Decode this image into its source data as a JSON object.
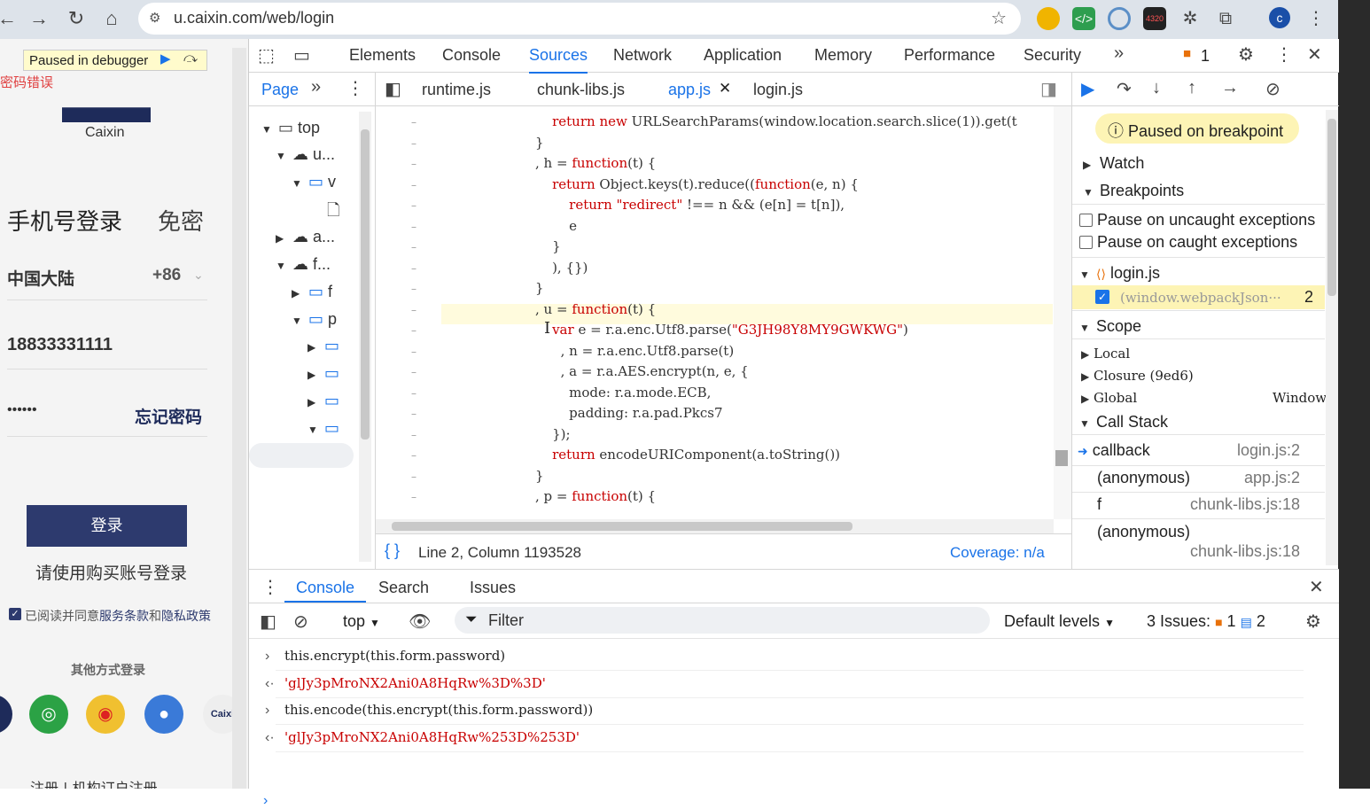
{
  "browser": {
    "url": "u.caixin.com/web/login"
  },
  "page": {
    "debugger_badge": "Paused in debugger",
    "error_text": "密码错误",
    "logo_text": "Caixin",
    "tab_phone": "手机号登录",
    "tab_free": "免密",
    "region": "中国大陆",
    "code": "+86",
    "phone": "18833331111",
    "password_mask": "••••••",
    "forgot": "忘记密码",
    "login_btn": "登录",
    "hint": "请使用购买账号登录",
    "agree_pre": "已阅读并同意",
    "agree_terms": "服务条款",
    "agree_and": "和",
    "agree_privacy": "隐私政策",
    "other": "其他方式登录",
    "footer": "注册 | 机构订户注册"
  },
  "devtools": {
    "tabs": [
      "Elements",
      "Console",
      "Sources",
      "Network",
      "Application",
      "Memory",
      "Performance",
      "Security"
    ],
    "issues_count": "1",
    "nav_tab": "Page",
    "tree": {
      "top": "top",
      "u": "u...",
      "v": "v",
      "a": "a...",
      "f": "f...",
      "f2": "f",
      "p": "p"
    },
    "file_tabs": [
      "runtime.js",
      "chunk-libs.js",
      "app.js",
      "login.js"
    ],
    "code_lines": [
      "    return new URLSearchParams(window.location.search.slice(1)).get(t",
      "}",
      ", h = function(t) {",
      "    return Object.keys(t).reduce((function(e, n) {",
      "        return \"redirect\" !== n && (e[n] = t[n]),",
      "        e",
      "    }",
      "    ), {})",
      "}",
      ", u = function(t) {",
      "    var e = r.a.enc.Utf8.parse(\"G3JH98Y8MY9GWKWG\")",
      "      , n = r.a.enc.Utf8.parse(t)",
      "      , a = r.a.AES.encrypt(n, e, {",
      "        mode: r.a.mode.ECB,",
      "        padding: r.a.pad.Pkcs7",
      "    });",
      "    return encodeURIComponent(a.toString())",
      "}",
      ", p = function(t) {"
    ],
    "status": {
      "position": "Line 2, Column 1193528",
      "coverage": "Coverage: n/a"
    },
    "debugger": {
      "paused": "Paused on breakpoint",
      "watch": "Watch",
      "breakpoints": "Breakpoints",
      "uncaught": "Pause on uncaught exceptions",
      "caught": "Pause on caught exceptions",
      "bp_file": "login.js",
      "bp_code": "(window.webpackJson···",
      "bp_line": "2",
      "scope": "Scope",
      "local": "Local",
      "closure": "Closure (9ed6)",
      "global": "Global",
      "global_val": "Window",
      "callstack": "Call Stack",
      "frames": [
        {
          "name": "callback",
          "loc": "login.js:2"
        },
        {
          "name": "(anonymous)",
          "loc": "app.js:2"
        },
        {
          "name": "f",
          "loc": "chunk-libs.js:18"
        },
        {
          "name": "(anonymous)",
          "loc": "chunk-libs.js:18"
        }
      ]
    },
    "drawer": {
      "tabs": [
        "Console",
        "Search",
        "Issues"
      ],
      "context": "top",
      "filter": "Filter",
      "levels": "Default levels",
      "issues_label": "3 Issues:",
      "issues_warn": "1",
      "issues_info": "2",
      "lines": [
        {
          "type": "in",
          "text": "this.encrypt(this.form.password)"
        },
        {
          "type": "out",
          "text": "'glJy3pMroNX2Ani0A8HqRw%3D%3D'"
        },
        {
          "type": "in",
          "text": "this.encode(this.encrypt(this.form.password))"
        },
        {
          "type": "out",
          "text": "'glJy3pMroNX2Ani0A8HqRw%253D%253D'"
        }
      ]
    }
  },
  "colors": {
    "accent": "#1a73e8",
    "string": "#c80000",
    "login_btn": "#2d3a6e"
  }
}
